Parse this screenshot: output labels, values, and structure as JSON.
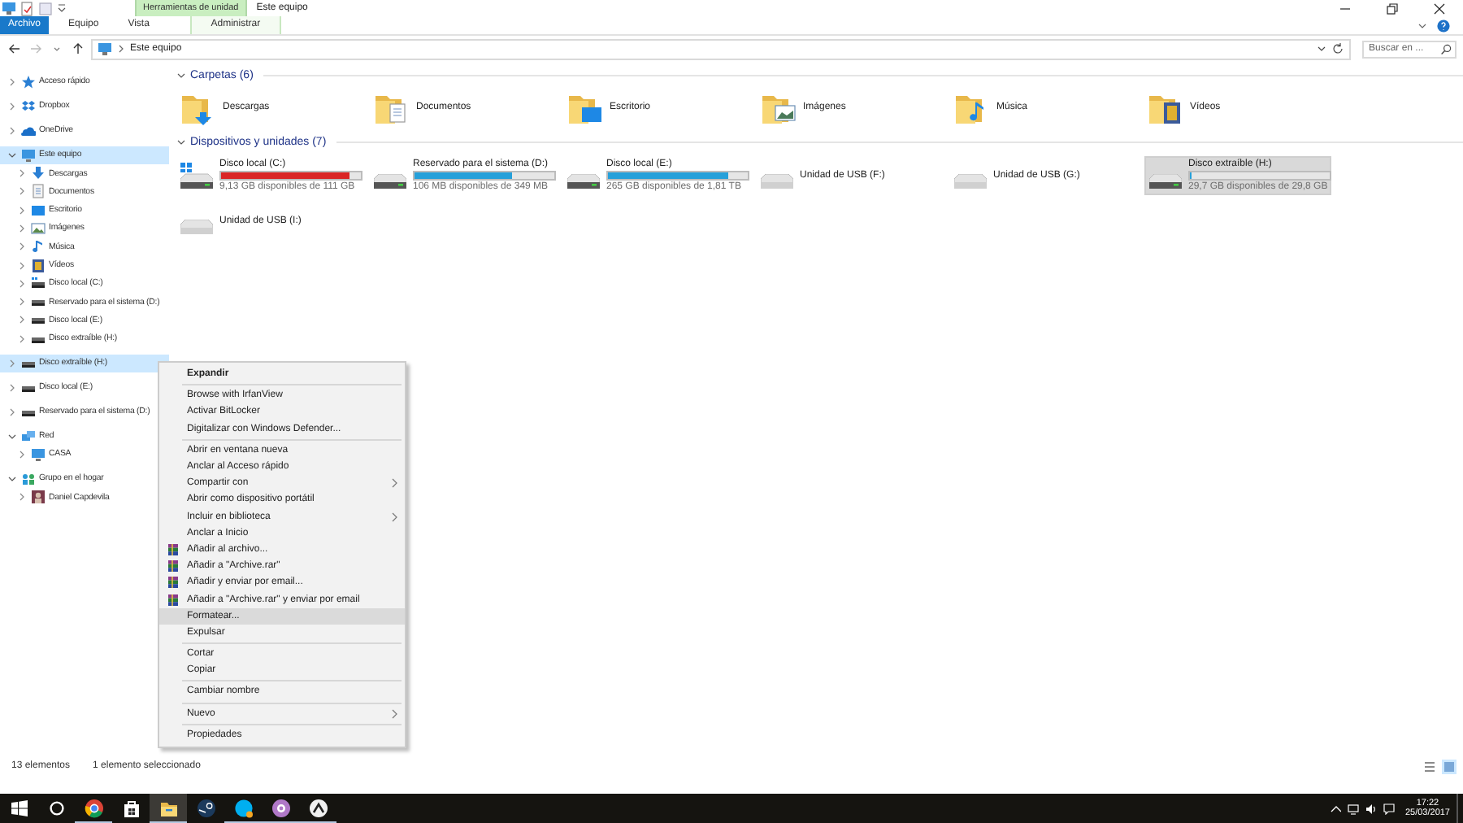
{
  "window": {
    "title": "Este equipo",
    "context_tab": "Herramientas de unidad"
  },
  "ribbon_tabs": [
    {
      "label": "Archivo",
      "kind": "file",
      "selected": false
    },
    {
      "label": "Equipo",
      "kind": "tab",
      "selected": false
    },
    {
      "label": "Vista",
      "kind": "tab",
      "selected": false
    },
    {
      "label": "Administrar",
      "kind": "context",
      "selected": false
    }
  ],
  "address": {
    "path": "Este equipo",
    "search_placeholder": "Buscar en ..."
  },
  "tree": [
    {
      "label": "Acceso rápido",
      "kind": "star",
      "selected": false,
      "expanded": false
    },
    {
      "label": "Dropbox",
      "kind": "dropbox",
      "selected": false,
      "expanded": false
    },
    {
      "label": "OneDrive",
      "kind": "cloud",
      "selected": false,
      "expanded": false
    },
    {
      "label": "Este equipo",
      "kind": "pc",
      "selected": true,
      "expanded": true,
      "children": [
        {
          "label": "Descargas",
          "kind": "download",
          "selected": false,
          "expanded": false
        },
        {
          "label": "Documentos",
          "kind": "doc",
          "selected": false,
          "expanded": false
        },
        {
          "label": "Escritorio",
          "kind": "desktop",
          "selected": false,
          "expanded": false
        },
        {
          "label": "Imágenes",
          "kind": "image",
          "selected": false,
          "expanded": false
        },
        {
          "label": "Música",
          "kind": "music",
          "selected": false,
          "expanded": false
        },
        {
          "label": "Vídeos",
          "kind": "video",
          "selected": false,
          "expanded": false
        },
        {
          "label": "Disco local (C:)",
          "kind": "sysdrive",
          "selected": false,
          "expanded": false
        },
        {
          "label": "Reservado para el sistema (D:)",
          "kind": "drive",
          "selected": false,
          "expanded": false
        },
        {
          "label": "Disco local (E:)",
          "kind": "drive",
          "selected": false,
          "expanded": false
        },
        {
          "label": "Disco extraíble (H:)",
          "kind": "drive",
          "selected": false,
          "expanded": false
        }
      ]
    },
    {
      "label": "Disco extraíble (H:)",
      "kind": "drive",
      "selected": true,
      "expanded": false
    },
    {
      "label": "Disco local (E:)",
      "kind": "drive",
      "selected": false,
      "expanded": false
    },
    {
      "label": "Reservado para el sistema (D:)",
      "kind": "drive",
      "selected": false,
      "expanded": false
    },
    {
      "label": "Red",
      "kind": "network",
      "selected": false,
      "expanded": true,
      "children": [
        {
          "label": "CASA",
          "kind": "pc",
          "selected": false,
          "expanded": false
        }
      ]
    },
    {
      "label": "Grupo en el hogar",
      "kind": "homegroup",
      "selected": false,
      "expanded": true,
      "children": [
        {
          "label": "Daniel Capdevila",
          "kind": "user",
          "selected": false,
          "expanded": false
        }
      ]
    }
  ],
  "folders": {
    "title": "Carpetas (6)",
    "expanded": true,
    "items": [
      {
        "label": "Descargas",
        "kind": "download"
      },
      {
        "label": "Documentos",
        "kind": "doc"
      },
      {
        "label": "Escritorio",
        "kind": "desktop"
      },
      {
        "label": "Imágenes",
        "kind": "image"
      },
      {
        "label": "Música",
        "kind": "music"
      },
      {
        "label": "Vídeos",
        "kind": "video"
      }
    ]
  },
  "devices": {
    "title": "Dispositivos y unidades (7)",
    "expanded": true,
    "items": [
      {
        "name": "Disco local (C:)",
        "kind": "sysdrive",
        "level": 0.92,
        "low_space": true,
        "free": "9,13 GB disponibles de 111 GB",
        "selected": false
      },
      {
        "name": "Reservado para el sistema (D:)",
        "kind": "drive",
        "level": 0.7,
        "low_space": false,
        "free": "106 MB disponibles de 349 MB",
        "selected": false
      },
      {
        "name": "Disco local (E:)",
        "kind": "drive",
        "level": 0.86,
        "low_space": false,
        "free": "265 GB disponibles de 1,81 TB",
        "selected": false
      },
      {
        "name": "Unidad de USB (F:)",
        "kind": "usb",
        "selected": false
      },
      {
        "name": "Unidad de USB (G:)",
        "kind": "usb",
        "selected": false
      },
      {
        "name": "Disco extraíble (H:)",
        "kind": "drive",
        "level": 0.004,
        "low_space": false,
        "free": "29,7 GB disponibles de 29,8 GB",
        "selected": true
      },
      {
        "name": "Unidad de USB (I:)",
        "kind": "usb",
        "selected": false
      }
    ]
  },
  "context_menu": [
    {
      "kind": "item",
      "label": "Expandir",
      "bold": true,
      "selected": false
    },
    {
      "kind": "separator"
    },
    {
      "kind": "item",
      "label": "Browse with IrfanView",
      "selected": false
    },
    {
      "kind": "item",
      "label": "Activar BitLocker",
      "selected": false
    },
    {
      "kind": "item",
      "label": "Digitalizar con Windows Defender...",
      "selected": false
    },
    {
      "kind": "separator"
    },
    {
      "kind": "item",
      "label": "Abrir en ventana nueva",
      "selected": false
    },
    {
      "kind": "item",
      "label": "Anclar al Acceso rápido",
      "selected": false
    },
    {
      "kind": "item",
      "label": "Compartir con",
      "submenu": true,
      "selected": false
    },
    {
      "kind": "item",
      "label": "Abrir como dispositivo portátil",
      "selected": false
    },
    {
      "kind": "item",
      "label": "Incluir en biblioteca",
      "submenu": true,
      "selected": false
    },
    {
      "kind": "item",
      "label": "Anclar a Inicio",
      "selected": false
    },
    {
      "kind": "archive_item",
      "label": "Añadir al archivo...",
      "selected": false
    },
    {
      "kind": "archive_item",
      "label": "Añadir a \"Archive.rar\"",
      "selected": false
    },
    {
      "kind": "archive_item",
      "label": "Añadir y enviar por email...",
      "selected": false
    },
    {
      "kind": "archive_item",
      "label": "Añadir a \"Archive.rar\" y enviar por email",
      "selected": false
    },
    {
      "kind": "item",
      "label": "Formatear...",
      "selected": true
    },
    {
      "kind": "item",
      "label": "Expulsar",
      "selected": false
    },
    {
      "kind": "separator"
    },
    {
      "kind": "item",
      "label": "Cortar",
      "selected": false
    },
    {
      "kind": "item",
      "label": "Copiar",
      "selected": false
    },
    {
      "kind": "separator"
    },
    {
      "kind": "item",
      "label": "Cambiar nombre",
      "selected": false
    },
    {
      "kind": "separator"
    },
    {
      "kind": "item",
      "label": "Nuevo",
      "submenu": true,
      "selected": false
    },
    {
      "kind": "separator"
    },
    {
      "kind": "item",
      "label": "Propiedades",
      "selected": false
    }
  ],
  "status_bar": {
    "count": "13 elementos",
    "selection": "1 elemento seleccionado"
  },
  "taskbar": {
    "apps": [
      {
        "kind": "browser",
        "running": true,
        "selected": false
      },
      {
        "kind": "store",
        "running": false,
        "selected": false
      },
      {
        "kind": "explorer",
        "running": true,
        "selected": true
      },
      {
        "kind": "steam",
        "running": false,
        "selected": false
      },
      {
        "kind": "skype",
        "running": true,
        "selected": false
      },
      {
        "kind": "purple",
        "running": true,
        "selected": false
      },
      {
        "kind": "steam2",
        "running": true,
        "selected": false
      }
    ],
    "time": "17:22",
    "date": "25/03/2017"
  }
}
